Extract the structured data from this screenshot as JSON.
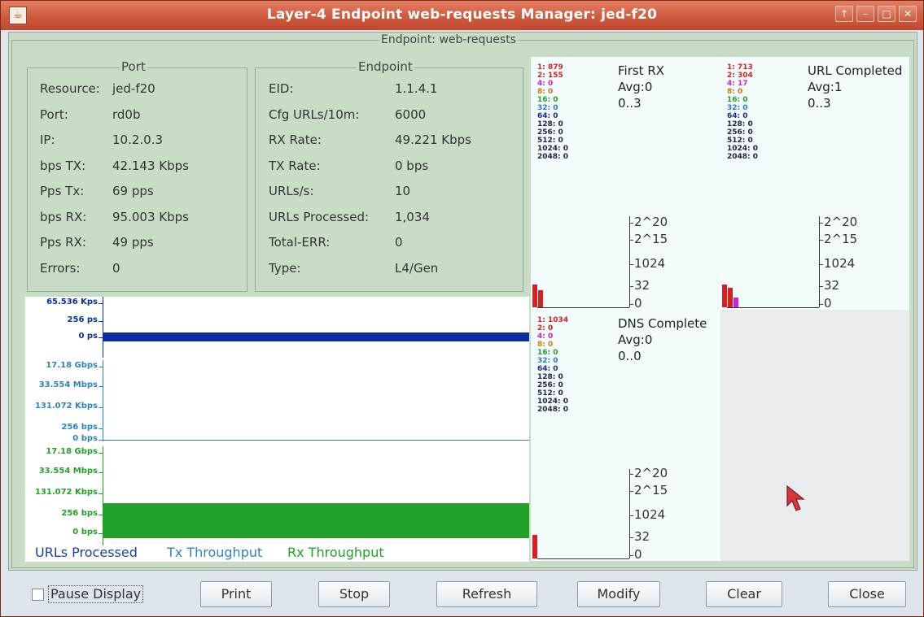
{
  "window": {
    "title": "Layer-4 Endpoint web-requests  Manager: jed-f20",
    "controls": [
      "↑",
      "–",
      "□",
      "✕"
    ]
  },
  "group_title": "Endpoint: web-requests",
  "port": {
    "title": "Port",
    "rows": [
      {
        "label": "Resource:",
        "value": "jed-f20"
      },
      {
        "label": "Port:",
        "value": "rd0b"
      },
      {
        "label": "IP:",
        "value": "10.2.0.3"
      },
      {
        "label": "bps TX:",
        "value": "42.143 Kbps"
      },
      {
        "label": "Pps Tx:",
        "value": "69 pps"
      },
      {
        "label": "bps RX:",
        "value": "95.003 Kbps"
      },
      {
        "label": "Pps RX:",
        "value": "49 pps"
      },
      {
        "label": "Errors:",
        "value": "0"
      }
    ]
  },
  "endpoint": {
    "title": "Endpoint",
    "rows": [
      {
        "label": "EID:",
        "value": "1.1.4.1"
      },
      {
        "label": "Cfg URLs/10m:",
        "value": "6000"
      },
      {
        "label": "RX Rate:",
        "value": "49.221 Kbps"
      },
      {
        "label": "TX Rate:",
        "value": "0 bps"
      },
      {
        "label": "URLs/s:",
        "value": "10"
      },
      {
        "label": "URLs Processed:",
        "value": "1,034"
      },
      {
        "label": "Total-ERR:",
        "value": "0"
      },
      {
        "label": "Type:",
        "value": "L4/Gen"
      }
    ]
  },
  "graphs": {
    "urls": {
      "ticks": [
        "65.536 Kps",
        "256 ps",
        "0 ps"
      ],
      "color": "#0a2f9e",
      "level": 0
    },
    "tx": {
      "ticks": [
        "17.18 Gbps",
        "33.554 Mbps",
        "131.072 Kbps",
        "256 bps",
        "0 bps"
      ],
      "color": "#2e86b8",
      "level": 0
    },
    "rx": {
      "ticks": [
        "17.18 Gbps",
        "33.554 Mbps",
        "131.072 Kbps",
        "256 bps",
        "0 bps"
      ],
      "color": "#22a02a",
      "level": 0.38
    },
    "legend": {
      "urls": "URLs Processed",
      "tx": "Tx Throughput",
      "rx": "Rx Throughput"
    }
  },
  "histograms": [
    {
      "title": "First RX",
      "avg": "Avg:0",
      "range": "0..3",
      "bins": [
        "1: 879",
        "2: 155",
        "4: 0",
        "8: 0",
        "16: 0",
        "32: 0",
        "64: 0",
        "128: 0",
        "256: 0",
        "512: 0",
        "1024: 0",
        "2048: 0"
      ],
      "bars": [
        879,
        155,
        0
      ]
    },
    {
      "title": "URL Completed",
      "avg": "Avg:1",
      "range": "0..3",
      "bins": [
        "1: 713",
        "2: 304",
        "4: 17",
        "8: 0",
        "16: 0",
        "32: 0",
        "64: 0",
        "128: 0",
        "256: 0",
        "512: 0",
        "1024: 0",
        "2048: 0"
      ],
      "bars": [
        713,
        304,
        17
      ]
    },
    {
      "title": "DNS Complete",
      "avg": "Avg:0",
      "range": "0..0",
      "bins": [
        "1: 1034",
        "2: 0",
        "4: 0",
        "8: 0",
        "16: 0",
        "32: 0",
        "64: 0",
        "128: 0",
        "256: 0",
        "512: 0",
        "1024: 0",
        "2048: 0"
      ],
      "bars": [
        1034,
        0,
        0
      ]
    }
  ],
  "y_axis_labels": [
    "2^20",
    "2^15",
    "1024",
    "32",
    "0"
  ],
  "bin_colors": [
    "#d62020",
    "#d62020",
    "#d020d0",
    "#d07a10",
    "#2a9a2a",
    "#2a7ab8",
    "#202a8a",
    "#222244",
    "#222244",
    "#222244",
    "#222244",
    "#222244"
  ],
  "buttons": {
    "pause": "Pause Display",
    "print": "Print",
    "stop": "Stop",
    "refresh": "Refresh",
    "modify": "Modify",
    "clear": "Clear",
    "close": "Close"
  }
}
